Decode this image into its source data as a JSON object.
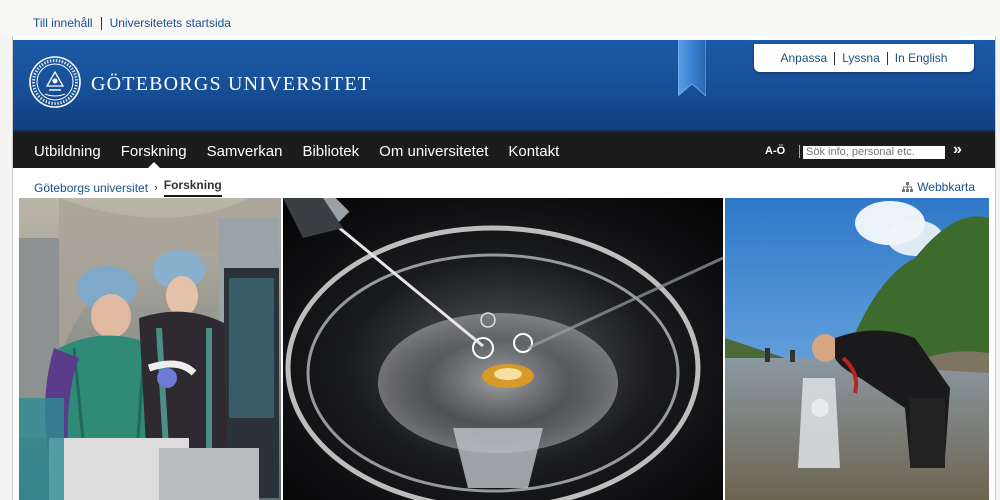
{
  "skip_links": [
    "Till innehåll",
    "Universitetets startsida"
  ],
  "brand": {
    "name": "GÖTEBORGS UNIVERSITET",
    "seal_text": "UNIVERSITAS GOTHOBURGENSIS",
    "seal_year": "1891",
    "color": "#1a56a0"
  },
  "tools": [
    "Anpassa",
    "Lyssna",
    "In English"
  ],
  "nav": {
    "items": [
      "Utbildning",
      "Forskning",
      "Samverkan",
      "Bibliotek",
      "Om universitetet",
      "Kontakt"
    ],
    "active": "Forskning",
    "az_label": "A-Ö",
    "search_placeholder": "Sök info, personal etc.",
    "search_go": "»"
  },
  "breadcrumb": {
    "root": "Göteborgs universitet",
    "separator": "›",
    "current": "Forskning"
  },
  "sitemap_label": "Webbkarta",
  "photos": [
    {
      "subject": "medical-researchers-photo"
    },
    {
      "subject": "petri-dish-micropipette-photo"
    },
    {
      "subject": "field-research-in-water-photo"
    }
  ]
}
